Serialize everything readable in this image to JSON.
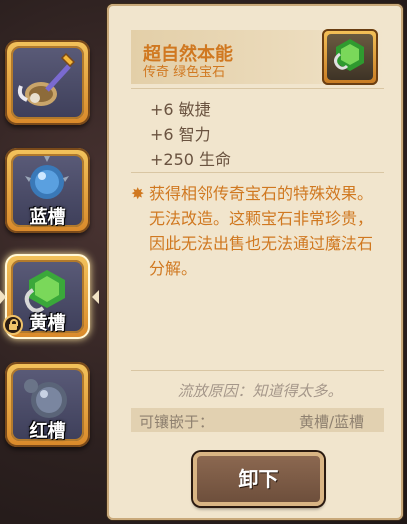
{
  "gem": {
    "title": "超自然本能",
    "subtitle": "传奇 绿色宝石",
    "icon": "green-gem-icon",
    "stats": [
      "+6 敏捷",
      "+6 智力",
      "+250 生命"
    ],
    "description": "获得相邻传奇宝石的特殊效果。无法改造。这颗宝石非常珍贵，因此无法出售也无法通过魔法石分解。",
    "exile_reason": "流放原因：知道得太多。",
    "socket_label": "可镶嵌于：",
    "socket_value": "黄槽/蓝槽",
    "unload_label": "卸下"
  },
  "slots": [
    {
      "icon": "lute-wrench-icon",
      "label": ""
    },
    {
      "icon": "blue-orb-icon",
      "label": "蓝槽"
    },
    {
      "icon": "green-gem-icon",
      "label": "黄槽",
      "locked": true
    },
    {
      "icon": "gray-orb-icon",
      "label": "红槽"
    }
  ],
  "colors": {
    "accent": "#d07820",
    "panel": "#f1e5cd",
    "muted": "#8f8170"
  }
}
